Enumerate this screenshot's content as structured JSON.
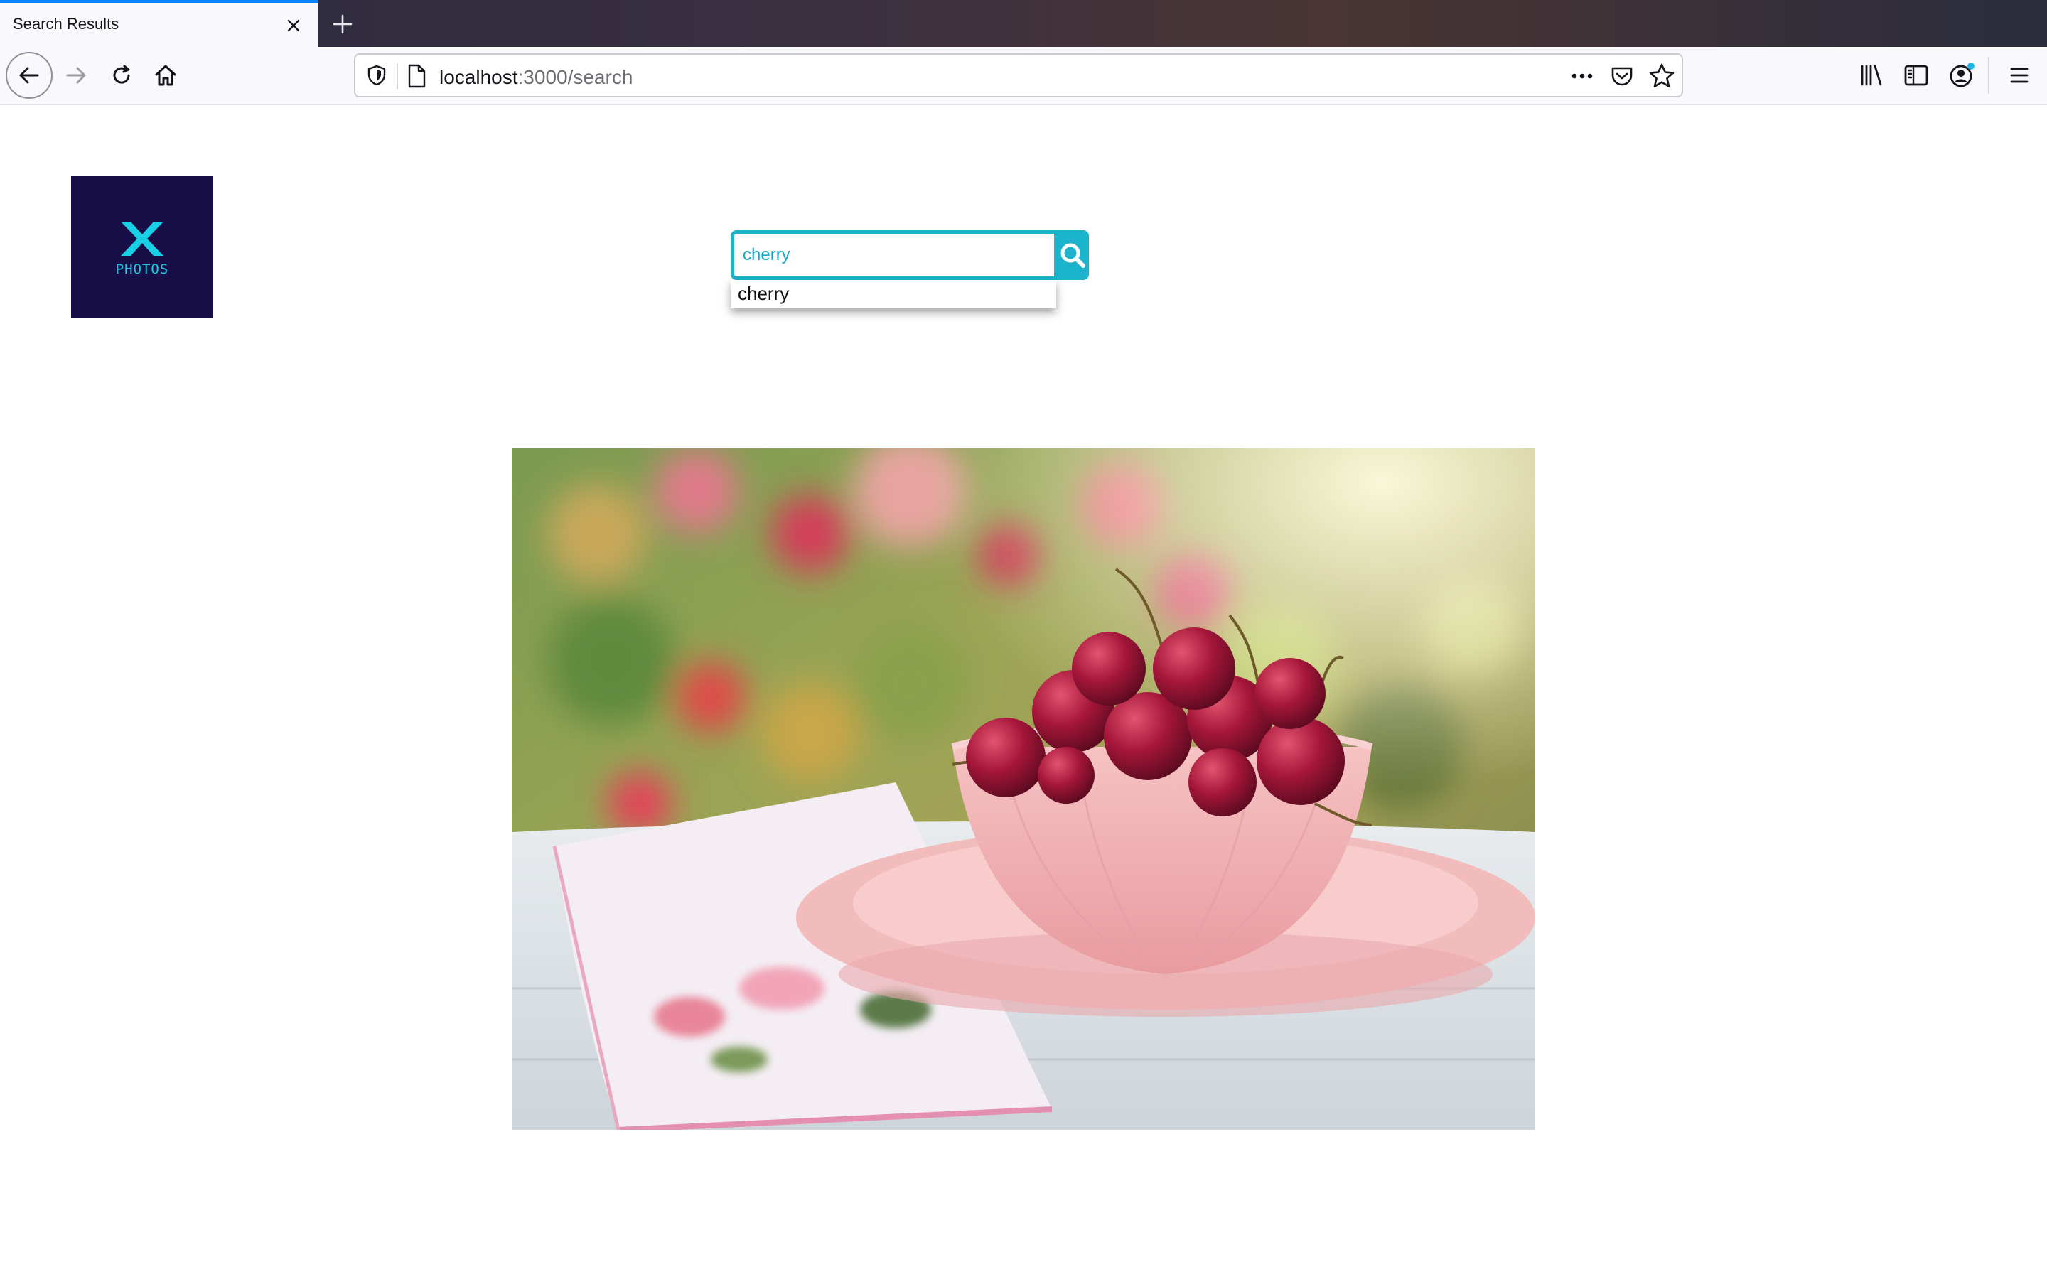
{
  "browser": {
    "tab": {
      "title": "Search Results"
    },
    "url": {
      "host": "localhost",
      "path": ":3000/search"
    }
  },
  "colors": {
    "accent": "#1cb3cc",
    "logo_bg": "#170e47",
    "logo_fg": "#18d0e6",
    "tab_highlight": "#0a84ff"
  },
  "icons": {
    "tab_close": "close-icon",
    "new_tab": "plus-icon",
    "back": "arrow-left-icon",
    "forward": "arrow-right-icon",
    "reload": "reload-icon",
    "home": "home-icon",
    "tracking": "shield-icon",
    "page": "page-icon",
    "page_actions": "ellipsis-icon",
    "pocket": "pocket-icon",
    "bookmark": "star-icon",
    "library": "library-icon",
    "sidebar": "sidebar-icon",
    "account": "account-icon",
    "menu": "hamburger-menu-icon",
    "search": "search-icon"
  },
  "page": {
    "logo": {
      "text": "PHOTOS"
    },
    "search": {
      "value": "cherry"
    },
    "suggestions": [
      "cherry"
    ]
  }
}
